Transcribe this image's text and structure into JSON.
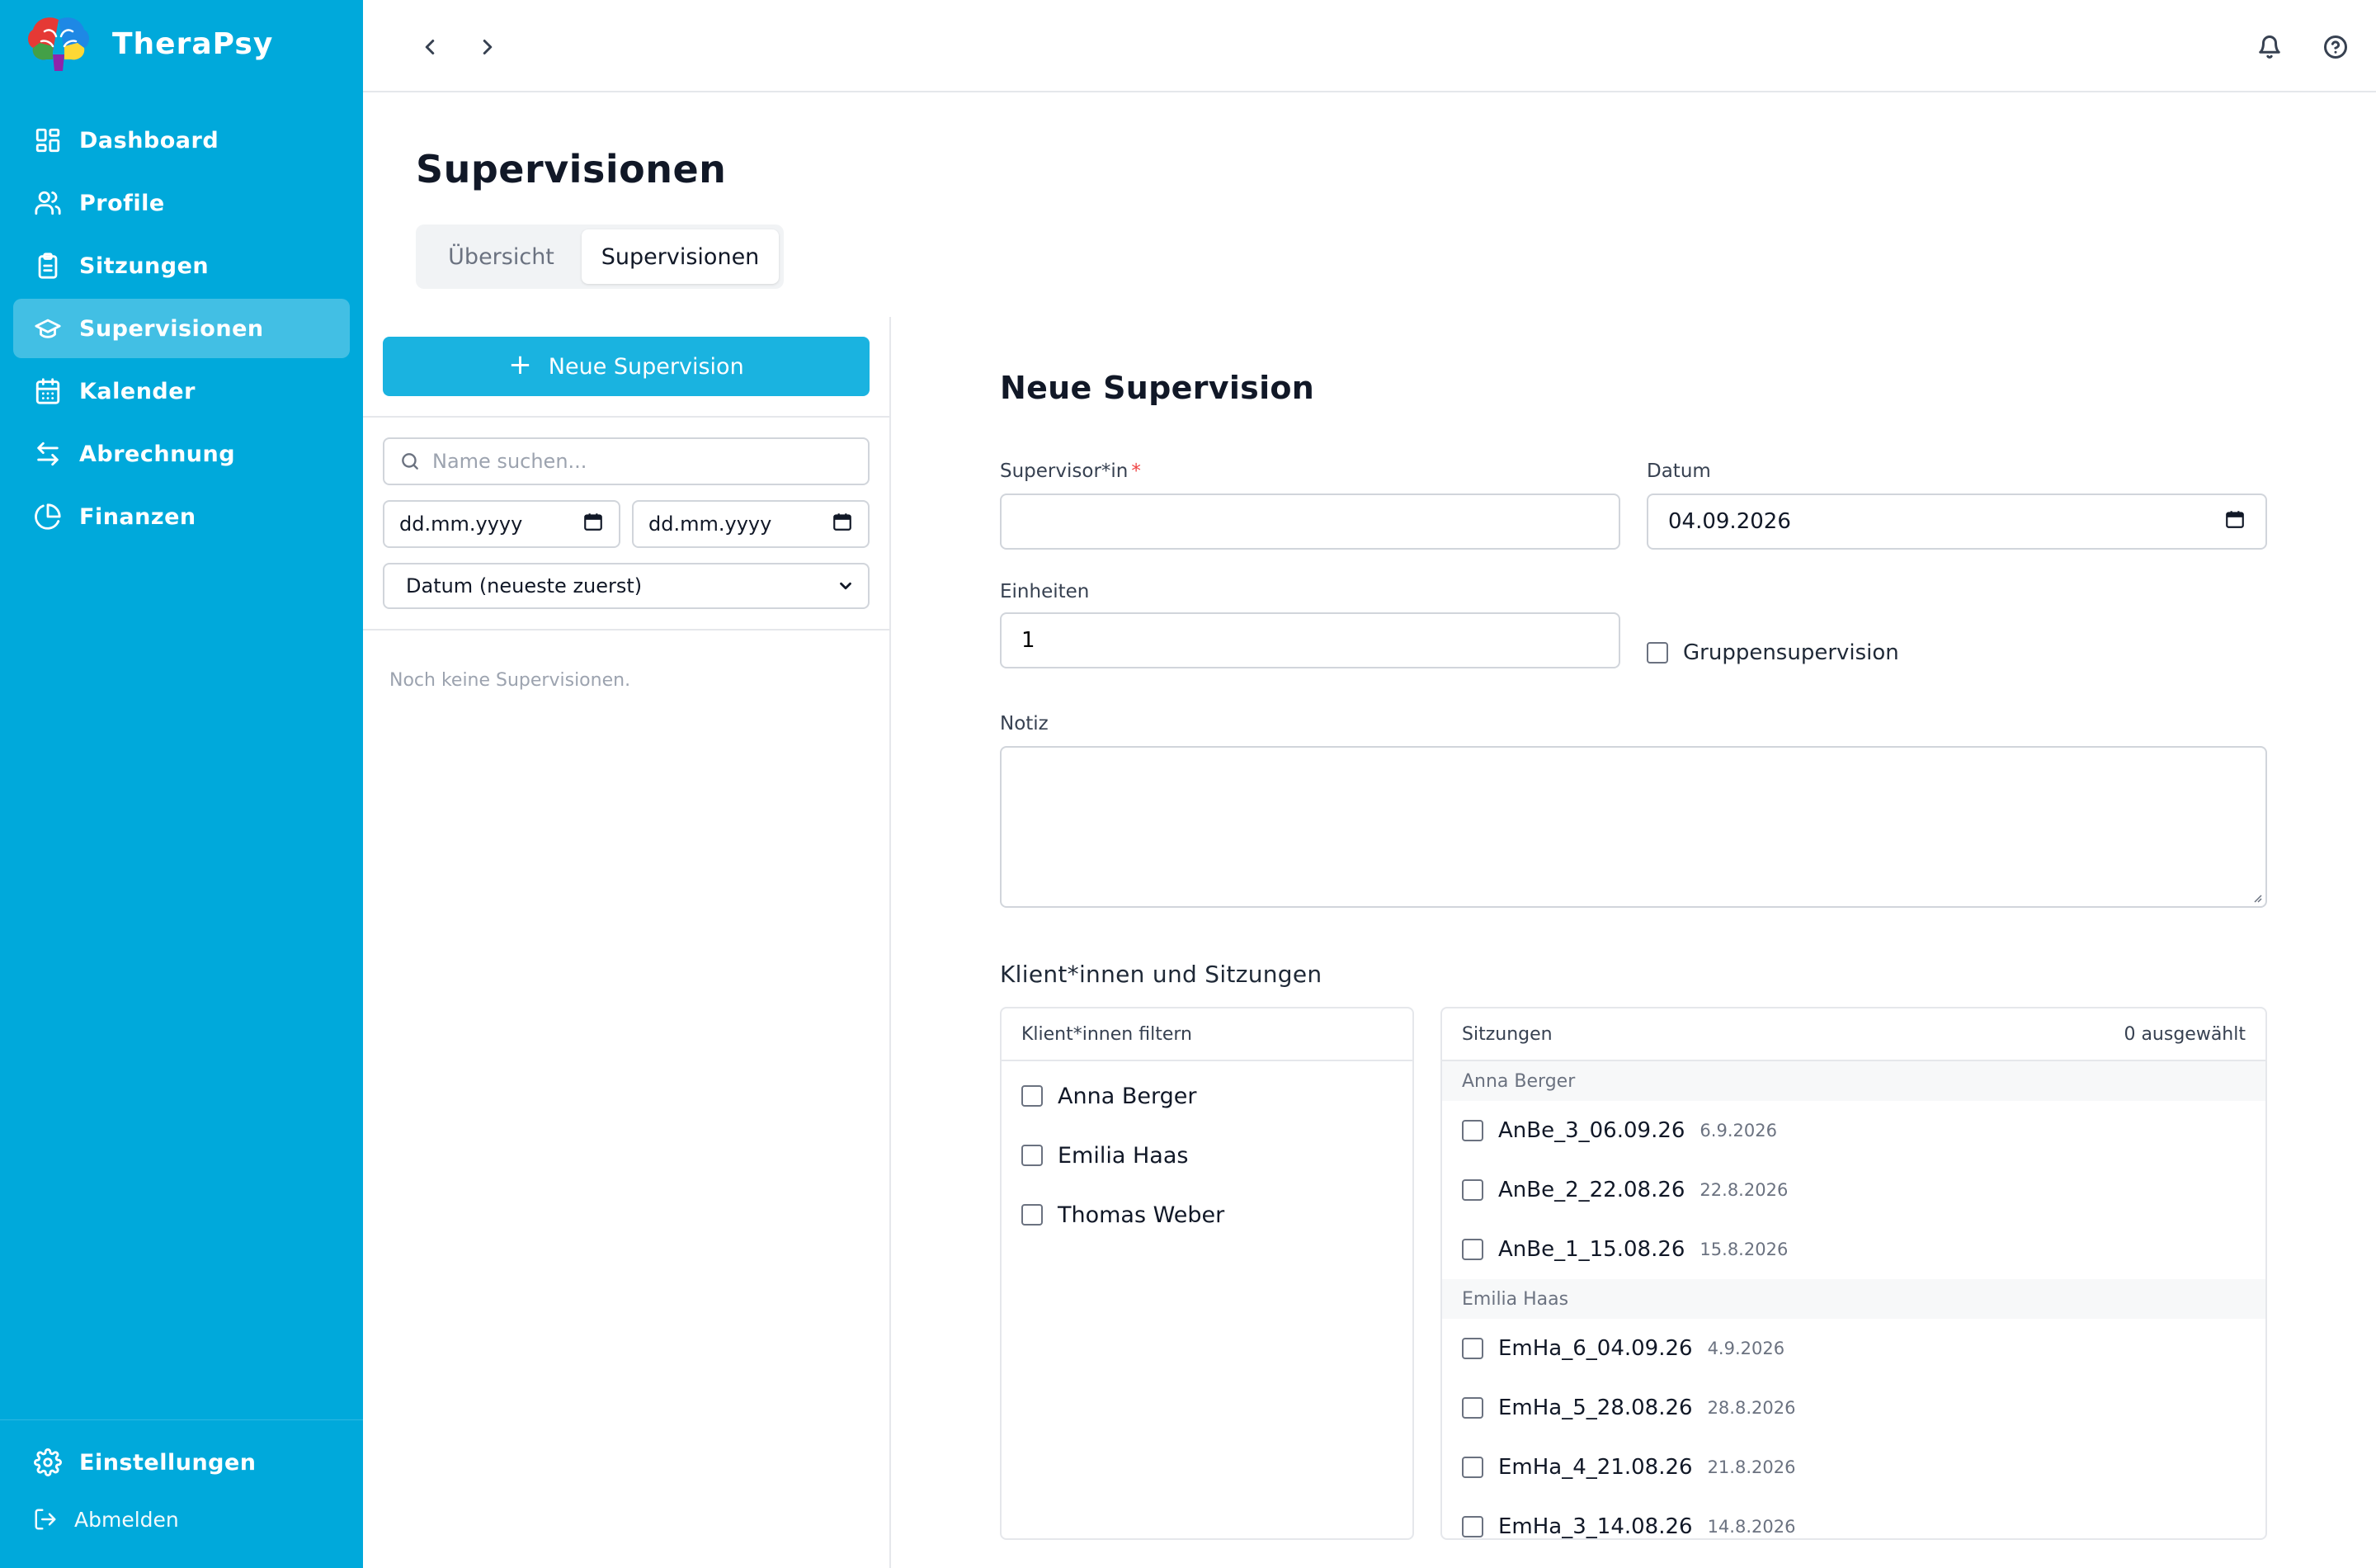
{
  "brand": {
    "name": "TheraPsy"
  },
  "sidebar": {
    "items": [
      {
        "label": "Dashboard",
        "icon": "dashboard-icon",
        "active": false
      },
      {
        "label": "Profile",
        "icon": "users-icon",
        "active": false
      },
      {
        "label": "Sitzungen",
        "icon": "clipboard-icon",
        "active": false
      },
      {
        "label": "Supervisionen",
        "icon": "graduation-cap-icon",
        "active": true
      },
      {
        "label": "Kalender",
        "icon": "calendar-icon",
        "active": false
      },
      {
        "label": "Abrechnung",
        "icon": "arrows-exchange-icon",
        "active": false
      },
      {
        "label": "Finanzen",
        "icon": "pie-chart-icon",
        "active": false
      }
    ],
    "settings_label": "Einstellungen",
    "logout_label": "Abmelden"
  },
  "topbar": {
    "back_icon": "chevron-left-icon",
    "forward_icon": "chevron-right-icon",
    "bell_icon": "bell-icon",
    "help_icon": "help-circle-icon"
  },
  "page": {
    "title": "Supervisionen",
    "tabs": [
      {
        "label": "Übersicht",
        "active": false
      },
      {
        "label": "Supervisionen",
        "active": true
      }
    ]
  },
  "list_panel": {
    "new_button": "Neue Supervision",
    "search_placeholder": "Name suchen...",
    "date_from": "dd.mm.yyyy",
    "date_to": "dd.mm.yyyy",
    "sort_selected": "Datum (neueste zuerst)",
    "empty_text": "Noch keine Supervisionen."
  },
  "form": {
    "title": "Neue Supervision",
    "supervisor_label": "Supervisor*in",
    "supervisor_required": "*",
    "supervisor_value": "",
    "date_label": "Datum",
    "date_value": "04.09.2026",
    "units_label": "Einheiten",
    "units_value": "1",
    "group_label": "Gruppensupervision",
    "note_label": "Notiz",
    "note_value": "",
    "clients_section_title": "Klient*innen und Sitzungen",
    "client_filter_header": "Klient*innen filtern",
    "clients": [
      "Anna Berger",
      "Emilia Haas",
      "Thomas Weber"
    ],
    "sessions_header": "Sitzungen",
    "selected_count": "0 ausgewählt",
    "session_groups": [
      {
        "client": "Anna Berger",
        "sessions": [
          {
            "name": "AnBe_3_06.09.26",
            "date": "6.9.2026"
          },
          {
            "name": "AnBe_2_22.08.26",
            "date": "22.8.2026"
          },
          {
            "name": "AnBe_1_15.08.26",
            "date": "15.8.2026"
          }
        ]
      },
      {
        "client": "Emilia Haas",
        "sessions": [
          {
            "name": "EmHa_6_04.09.26",
            "date": "4.9.2026"
          },
          {
            "name": "EmHa_5_28.08.26",
            "date": "28.8.2026"
          },
          {
            "name": "EmHa_4_21.08.26",
            "date": "21.8.2026"
          },
          {
            "name": "EmHa_3_14.08.26",
            "date": "14.8.2026"
          }
        ]
      }
    ]
  },
  "colors": {
    "sidebar": "#00a9db",
    "primary_button": "#1ab3e0",
    "required": "#ef4444"
  }
}
